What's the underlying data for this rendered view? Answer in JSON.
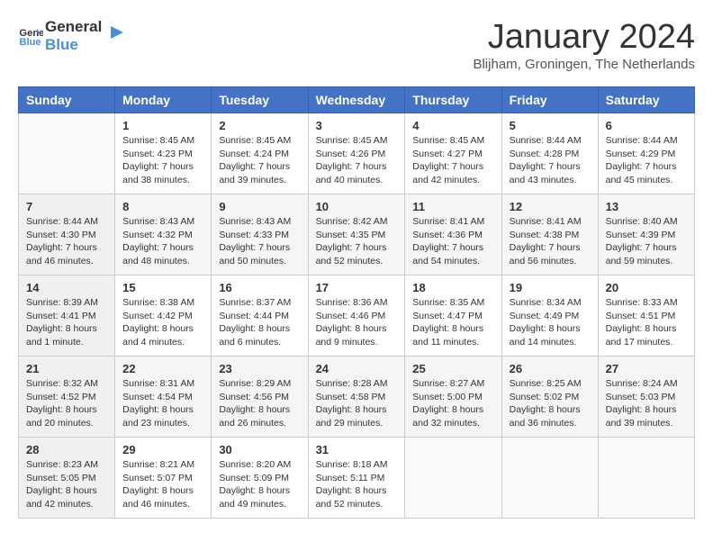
{
  "header": {
    "logo": {
      "text_general": "General",
      "text_blue": "Blue"
    },
    "title": "January 2024",
    "location": "Blijham, Groningen, The Netherlands"
  },
  "calendar": {
    "headers": [
      "Sunday",
      "Monday",
      "Tuesday",
      "Wednesday",
      "Thursday",
      "Friday",
      "Saturday"
    ],
    "weeks": [
      [
        {
          "day": "",
          "sunrise": "",
          "sunset": "",
          "daylight": ""
        },
        {
          "day": "1",
          "sunrise": "Sunrise: 8:45 AM",
          "sunset": "Sunset: 4:23 PM",
          "daylight": "Daylight: 7 hours and 38 minutes."
        },
        {
          "day": "2",
          "sunrise": "Sunrise: 8:45 AM",
          "sunset": "Sunset: 4:24 PM",
          "daylight": "Daylight: 7 hours and 39 minutes."
        },
        {
          "day": "3",
          "sunrise": "Sunrise: 8:45 AM",
          "sunset": "Sunset: 4:26 PM",
          "daylight": "Daylight: 7 hours and 40 minutes."
        },
        {
          "day": "4",
          "sunrise": "Sunrise: 8:45 AM",
          "sunset": "Sunset: 4:27 PM",
          "daylight": "Daylight: 7 hours and 42 minutes."
        },
        {
          "day": "5",
          "sunrise": "Sunrise: 8:44 AM",
          "sunset": "Sunset: 4:28 PM",
          "daylight": "Daylight: 7 hours and 43 minutes."
        },
        {
          "day": "6",
          "sunrise": "Sunrise: 8:44 AM",
          "sunset": "Sunset: 4:29 PM",
          "daylight": "Daylight: 7 hours and 45 minutes."
        }
      ],
      [
        {
          "day": "7",
          "sunrise": "Sunrise: 8:44 AM",
          "sunset": "Sunset: 4:30 PM",
          "daylight": "Daylight: 7 hours and 46 minutes."
        },
        {
          "day": "8",
          "sunrise": "Sunrise: 8:43 AM",
          "sunset": "Sunset: 4:32 PM",
          "daylight": "Daylight: 7 hours and 48 minutes."
        },
        {
          "day": "9",
          "sunrise": "Sunrise: 8:43 AM",
          "sunset": "Sunset: 4:33 PM",
          "daylight": "Daylight: 7 hours and 50 minutes."
        },
        {
          "day": "10",
          "sunrise": "Sunrise: 8:42 AM",
          "sunset": "Sunset: 4:35 PM",
          "daylight": "Daylight: 7 hours and 52 minutes."
        },
        {
          "day": "11",
          "sunrise": "Sunrise: 8:41 AM",
          "sunset": "Sunset: 4:36 PM",
          "daylight": "Daylight: 7 hours and 54 minutes."
        },
        {
          "day": "12",
          "sunrise": "Sunrise: 8:41 AM",
          "sunset": "Sunset: 4:38 PM",
          "daylight": "Daylight: 7 hours and 56 minutes."
        },
        {
          "day": "13",
          "sunrise": "Sunrise: 8:40 AM",
          "sunset": "Sunset: 4:39 PM",
          "daylight": "Daylight: 7 hours and 59 minutes."
        }
      ],
      [
        {
          "day": "14",
          "sunrise": "Sunrise: 8:39 AM",
          "sunset": "Sunset: 4:41 PM",
          "daylight": "Daylight: 8 hours and 1 minute."
        },
        {
          "day": "15",
          "sunrise": "Sunrise: 8:38 AM",
          "sunset": "Sunset: 4:42 PM",
          "daylight": "Daylight: 8 hours and 4 minutes."
        },
        {
          "day": "16",
          "sunrise": "Sunrise: 8:37 AM",
          "sunset": "Sunset: 4:44 PM",
          "daylight": "Daylight: 8 hours and 6 minutes."
        },
        {
          "day": "17",
          "sunrise": "Sunrise: 8:36 AM",
          "sunset": "Sunset: 4:46 PM",
          "daylight": "Daylight: 8 hours and 9 minutes."
        },
        {
          "day": "18",
          "sunrise": "Sunrise: 8:35 AM",
          "sunset": "Sunset: 4:47 PM",
          "daylight": "Daylight: 8 hours and 11 minutes."
        },
        {
          "day": "19",
          "sunrise": "Sunrise: 8:34 AM",
          "sunset": "Sunset: 4:49 PM",
          "daylight": "Daylight: 8 hours and 14 minutes."
        },
        {
          "day": "20",
          "sunrise": "Sunrise: 8:33 AM",
          "sunset": "Sunset: 4:51 PM",
          "daylight": "Daylight: 8 hours and 17 minutes."
        }
      ],
      [
        {
          "day": "21",
          "sunrise": "Sunrise: 8:32 AM",
          "sunset": "Sunset: 4:52 PM",
          "daylight": "Daylight: 8 hours and 20 minutes."
        },
        {
          "day": "22",
          "sunrise": "Sunrise: 8:31 AM",
          "sunset": "Sunset: 4:54 PM",
          "daylight": "Daylight: 8 hours and 23 minutes."
        },
        {
          "day": "23",
          "sunrise": "Sunrise: 8:29 AM",
          "sunset": "Sunset: 4:56 PM",
          "daylight": "Daylight: 8 hours and 26 minutes."
        },
        {
          "day": "24",
          "sunrise": "Sunrise: 8:28 AM",
          "sunset": "Sunset: 4:58 PM",
          "daylight": "Daylight: 8 hours and 29 minutes."
        },
        {
          "day": "25",
          "sunrise": "Sunrise: 8:27 AM",
          "sunset": "Sunset: 5:00 PM",
          "daylight": "Daylight: 8 hours and 32 minutes."
        },
        {
          "day": "26",
          "sunrise": "Sunrise: 8:25 AM",
          "sunset": "Sunset: 5:02 PM",
          "daylight": "Daylight: 8 hours and 36 minutes."
        },
        {
          "day": "27",
          "sunrise": "Sunrise: 8:24 AM",
          "sunset": "Sunset: 5:03 PM",
          "daylight": "Daylight: 8 hours and 39 minutes."
        }
      ],
      [
        {
          "day": "28",
          "sunrise": "Sunrise: 8:23 AM",
          "sunset": "Sunset: 5:05 PM",
          "daylight": "Daylight: 8 hours and 42 minutes."
        },
        {
          "day": "29",
          "sunrise": "Sunrise: 8:21 AM",
          "sunset": "Sunset: 5:07 PM",
          "daylight": "Daylight: 8 hours and 46 minutes."
        },
        {
          "day": "30",
          "sunrise": "Sunrise: 8:20 AM",
          "sunset": "Sunset: 5:09 PM",
          "daylight": "Daylight: 8 hours and 49 minutes."
        },
        {
          "day": "31",
          "sunrise": "Sunrise: 8:18 AM",
          "sunset": "Sunset: 5:11 PM",
          "daylight": "Daylight: 8 hours and 52 minutes."
        },
        {
          "day": "",
          "sunrise": "",
          "sunset": "",
          "daylight": ""
        },
        {
          "day": "",
          "sunrise": "",
          "sunset": "",
          "daylight": ""
        },
        {
          "day": "",
          "sunrise": "",
          "sunset": "",
          "daylight": ""
        }
      ]
    ]
  }
}
